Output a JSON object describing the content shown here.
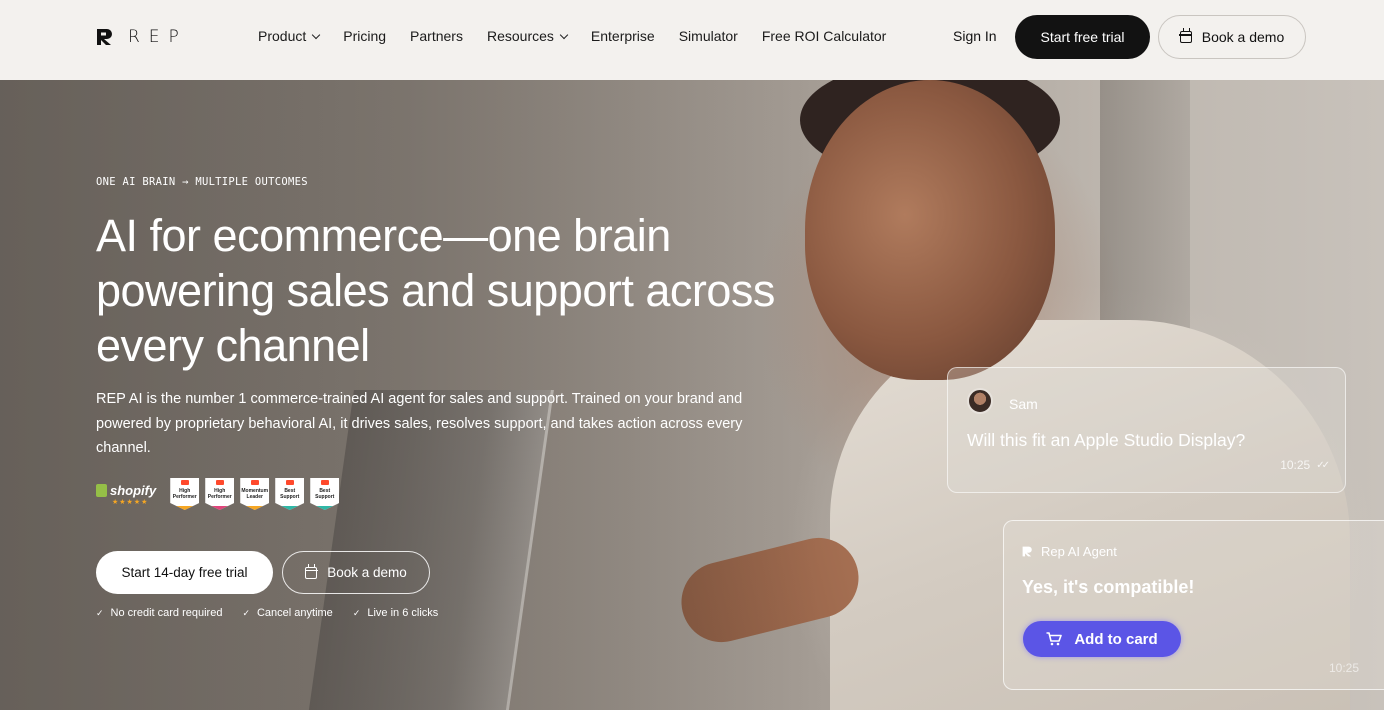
{
  "nav": {
    "logo_text": "REP",
    "menu": [
      {
        "label": "Product",
        "dropdown": true
      },
      {
        "label": "Pricing",
        "dropdown": false
      },
      {
        "label": "Partners",
        "dropdown": false
      },
      {
        "label": "Resources",
        "dropdown": true
      },
      {
        "label": "Enterprise",
        "dropdown": false
      },
      {
        "label": "Simulator",
        "dropdown": false
      },
      {
        "label": "Free ROI Calculator",
        "dropdown": false
      }
    ],
    "sign_in": "Sign In",
    "start_trial": "Start free trial",
    "book_demo": "Book a demo"
  },
  "hero": {
    "eyebrow": "ONE AI BRAIN → MULTIPLE OUTCOMES",
    "headline": "AI for ecommerce—one brain powering sales and support across every channel",
    "subheadline": "REP AI is the number 1 commerce-trained AI agent for sales and support. Trained on your brand and powered by proprietary behavioral AI, it drives sales, resolves support, and takes action across every channel.",
    "shopify_label": "shopify",
    "shopify_stars": "★★★★★",
    "g2_badges": [
      {
        "line1": "High",
        "line2": "Performer",
        "color": "#f5a623"
      },
      {
        "line1": "High",
        "line2": "Performer",
        "color": "#e0457b"
      },
      {
        "line1": "Momentum",
        "line2": "Leader",
        "color": "#f5a623"
      },
      {
        "line1": "Best",
        "line2": "Support",
        "color": "#2fb7a6"
      },
      {
        "line1": "Best",
        "line2": "Support",
        "color": "#2fb7a6"
      }
    ],
    "cta_primary": "Start 14-day free trial",
    "cta_secondary": "Book a demo",
    "checks": [
      "No credit card required",
      "Cancel anytime",
      "Live in 6 clicks"
    ]
  },
  "chat": {
    "user_name": "Sam",
    "question": "Will this fit an Apple Studio Display?",
    "question_time": "10:25",
    "agent_name": "Rep AI Agent",
    "answer": "Yes, it's compatible!",
    "add_to_cart": "Add to card",
    "answer_time": "10:25"
  },
  "colors": {
    "primary_dark": "#121212",
    "nav_bg": "#f3f1ee",
    "accent_button": "#5b55e6",
    "shopify_green": "#95bf47",
    "g2_red": "#ff492c"
  }
}
